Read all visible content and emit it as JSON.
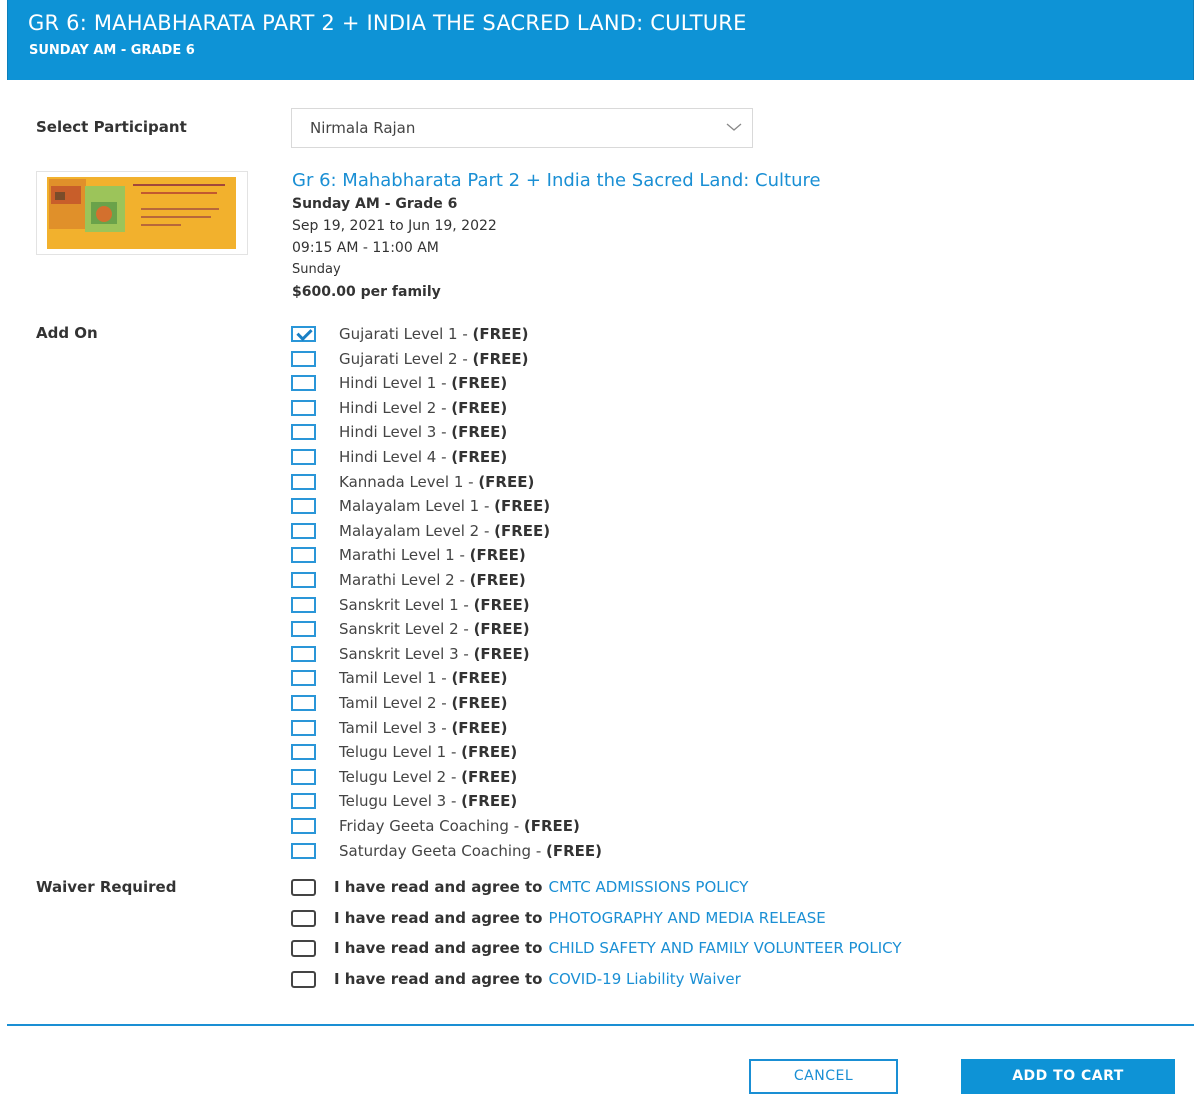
{
  "header": {
    "title": "GR 6: MAHABHARATA PART 2 + INDIA THE SACRED LAND: CULTURE",
    "subtitle": "SUNDAY AM - GRADE 6"
  },
  "participant": {
    "label": "Select Participant",
    "selected": "Nirmala Rajan"
  },
  "course": {
    "title": "Gr 6: Mahabharata Part 2 + India the Sacred Land: Culture",
    "session": "Sunday AM - Grade 6",
    "dates": "Sep 19, 2021 to Jun 19, 2022",
    "time": "09:15 AM - 11:00 AM",
    "day": "Sunday",
    "price": "$600.00 per family"
  },
  "addons": {
    "label": "Add On",
    "items": [
      {
        "name": "Gujarati Level 1 - ",
        "tag": "(FREE)",
        "checked": true
      },
      {
        "name": "Gujarati Level 2 - ",
        "tag": "(FREE)",
        "checked": false
      },
      {
        "name": "Hindi Level 1 - ",
        "tag": "(FREE)",
        "checked": false
      },
      {
        "name": "Hindi Level 2 - ",
        "tag": "(FREE)",
        "checked": false
      },
      {
        "name": "Hindi Level 3 - ",
        "tag": "(FREE)",
        "checked": false
      },
      {
        "name": "Hindi Level 4 - ",
        "tag": "(FREE)",
        "checked": false
      },
      {
        "name": "Kannada Level 1 - ",
        "tag": "(FREE)",
        "checked": false
      },
      {
        "name": "Malayalam Level 1 - ",
        "tag": "(FREE)",
        "checked": false
      },
      {
        "name": "Malayalam Level 2 - ",
        "tag": "(FREE)",
        "checked": false
      },
      {
        "name": "Marathi Level 1 - ",
        "tag": "(FREE)",
        "checked": false
      },
      {
        "name": "Marathi Level 2 - ",
        "tag": "(FREE)",
        "checked": false
      },
      {
        "name": "Sanskrit Level 1 - ",
        "tag": "(FREE)",
        "checked": false
      },
      {
        "name": "Sanskrit Level 2 - ",
        "tag": "(FREE)",
        "checked": false
      },
      {
        "name": "Sanskrit Level 3 - ",
        "tag": "(FREE)",
        "checked": false
      },
      {
        "name": "Tamil Level 1 - ",
        "tag": "(FREE)",
        "checked": false
      },
      {
        "name": "Tamil Level 2 - ",
        "tag": "(FREE)",
        "checked": false
      },
      {
        "name": "Tamil Level 3 - ",
        "tag": "(FREE)",
        "checked": false
      },
      {
        "name": "Telugu Level 1 - ",
        "tag": "(FREE)",
        "checked": false
      },
      {
        "name": "Telugu Level 2 - ",
        "tag": "(FREE)",
        "checked": false
      },
      {
        "name": "Telugu Level 3 - ",
        "tag": "(FREE)",
        "checked": false
      },
      {
        "name": "Friday Geeta Coaching - ",
        "tag": "(FREE)",
        "checked": false
      },
      {
        "name": "Saturday Geeta Coaching - ",
        "tag": "(FREE)",
        "checked": false
      }
    ]
  },
  "waiver": {
    "label": "Waiver Required",
    "prefix": "I have read and agree to",
    "items": [
      {
        "link": "CMTC ADMISSIONS POLICY"
      },
      {
        "link": "PHOTOGRAPHY AND MEDIA RELEASE"
      },
      {
        "link": "CHILD SAFETY AND FAMILY VOLUNTEER POLICY"
      },
      {
        "link": "COVID-19 Liability Waiver"
      }
    ]
  },
  "footer": {
    "cancel_label": "CANCEL",
    "add_label": "ADD TO CART"
  },
  "colors": {
    "accent": "#0e93d6",
    "link": "#1a8fd4"
  }
}
